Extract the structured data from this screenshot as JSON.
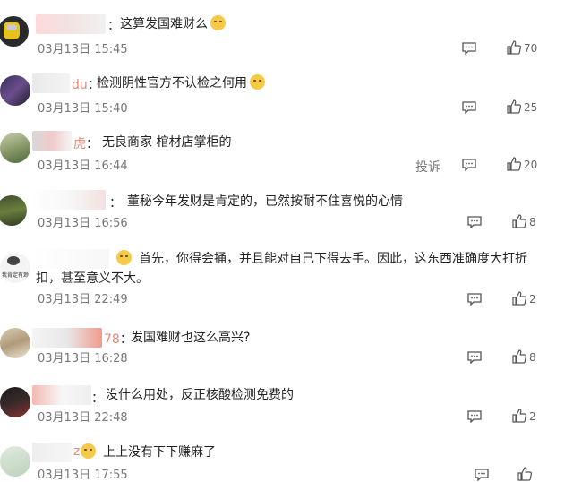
{
  "comments": [
    {
      "id": 1,
      "user_tail": "",
      "text": "这算发国难财么",
      "date": "03月13日 15:45",
      "likes": "70",
      "emoji": true
    },
    {
      "id": 2,
      "user_tail": "du",
      "text": "检测阴性官方不认检之何用",
      "date": "03月13日 15:40",
      "likes": "25",
      "emoji": true
    },
    {
      "id": 3,
      "user_tail": "虎",
      "text": "无良商家 棺材店掌柜的",
      "date": "03月13日 16:44",
      "likes": "20",
      "report": "投诉"
    },
    {
      "id": 4,
      "user_tail": "",
      "text": "董秘今年发财是肯定的，已然按耐不住喜悦的心情",
      "date": "03月13日 16:56",
      "likes": "8"
    },
    {
      "id": 5,
      "user_tail": "",
      "text": "首先，你得会捅，并且能对自己下得去手。因此，这东西准确度大打折扣，甚至意义不大。",
      "date": "03月13日 22:49",
      "likes": "2",
      "emoji_before": true,
      "avatar_text": "我肯定有渺"
    },
    {
      "id": 6,
      "user_tail": "78",
      "text": "发国难财也这么高兴?",
      "date": "03月13日 16:28",
      "likes": "8"
    },
    {
      "id": 7,
      "user_tail": "",
      "text": "没什么用处，反正核酸检测免费的",
      "date": "03月13日 22:48",
      "likes": "2"
    },
    {
      "id": 8,
      "user_tail": "z",
      "text": "上上没有下下赚麻了",
      "date": "03月13日 17:55",
      "likes": "",
      "emoji_before": true
    }
  ]
}
